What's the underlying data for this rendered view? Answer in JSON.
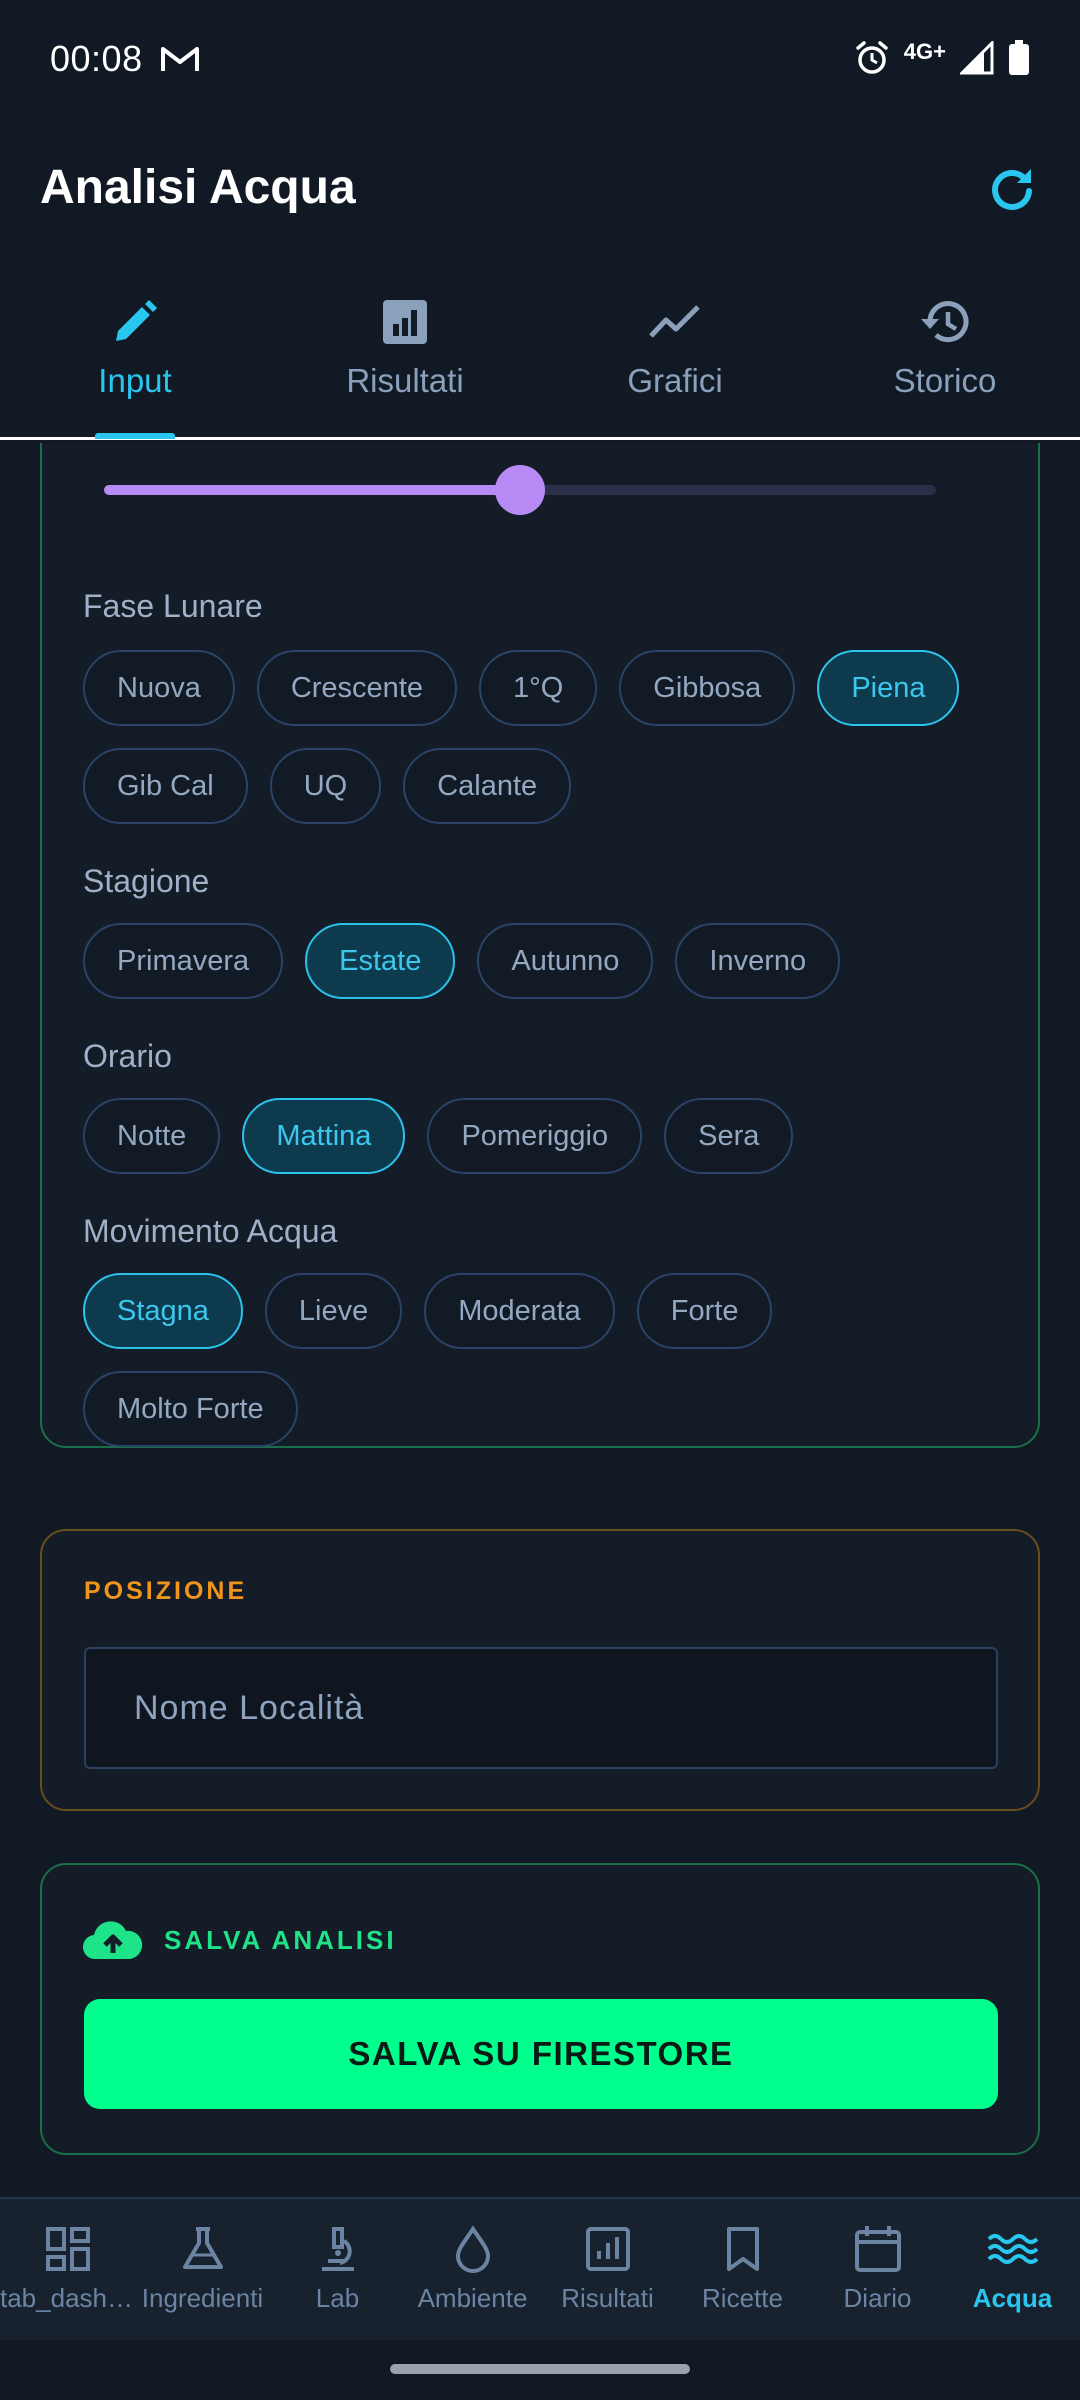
{
  "status_bar": {
    "time": "00:08",
    "network": "4G+"
  },
  "app_bar": {
    "title": "Analisi Acqua"
  },
  "tabs": [
    {
      "label": "Input",
      "icon": "pencil-icon",
      "active": true
    },
    {
      "label": "Risultati",
      "icon": "bar-chart-icon",
      "active": false
    },
    {
      "label": "Grafici",
      "icon": "line-chart-icon",
      "active": false
    },
    {
      "label": "Storico",
      "icon": "history-icon",
      "active": false
    }
  ],
  "slider": {
    "value_fraction": 0.5
  },
  "moon_phase": {
    "label": "Fase Lunare",
    "options": [
      "Nuova",
      "Crescente",
      "1°Q",
      "Gibbosa",
      "Piena",
      "Gib Cal",
      "UQ",
      "Calante"
    ],
    "selected": "Piena"
  },
  "season": {
    "label": "Stagione",
    "options": [
      "Primavera",
      "Estate",
      "Autunno",
      "Inverno"
    ],
    "selected": "Estate"
  },
  "time_of_day": {
    "label": "Orario",
    "options": [
      "Notte",
      "Mattina",
      "Pomeriggio",
      "Sera"
    ],
    "selected": "Mattina"
  },
  "water_movement": {
    "label": "Movimento Acqua",
    "options": [
      "Stagna",
      "Lieve",
      "Moderata",
      "Forte",
      "Molto Forte"
    ],
    "selected": "Stagna"
  },
  "position": {
    "title": "POSIZIONE",
    "placeholder": "Nome Località",
    "value": ""
  },
  "save": {
    "title": "SALVA ANALISI",
    "button_label": "SALVA SU FIRESTORE"
  },
  "bottom_nav": [
    {
      "label": "tab_dashboard",
      "icon": "dashboard-icon",
      "active": false
    },
    {
      "label": "Ingredienti",
      "icon": "flask-icon",
      "active": false
    },
    {
      "label": "Lab",
      "icon": "microscope-icon",
      "active": false
    },
    {
      "label": "Ambiente",
      "icon": "water-drop-icon",
      "active": false
    },
    {
      "label": "Risultati",
      "icon": "bar-chart-icon",
      "active": false
    },
    {
      "label": "Ricette",
      "icon": "bookmark-icon",
      "active": false
    },
    {
      "label": "Diario",
      "icon": "calendar-icon",
      "active": false
    },
    {
      "label": "Acqua",
      "icon": "waves-icon",
      "active": true
    }
  ],
  "colors": {
    "background": "#111a24",
    "accent_cyan": "#29c6f0",
    "accent_green": "#00ff8c",
    "accent_orange": "#f0951c",
    "slider_purple": "#b78af5"
  }
}
